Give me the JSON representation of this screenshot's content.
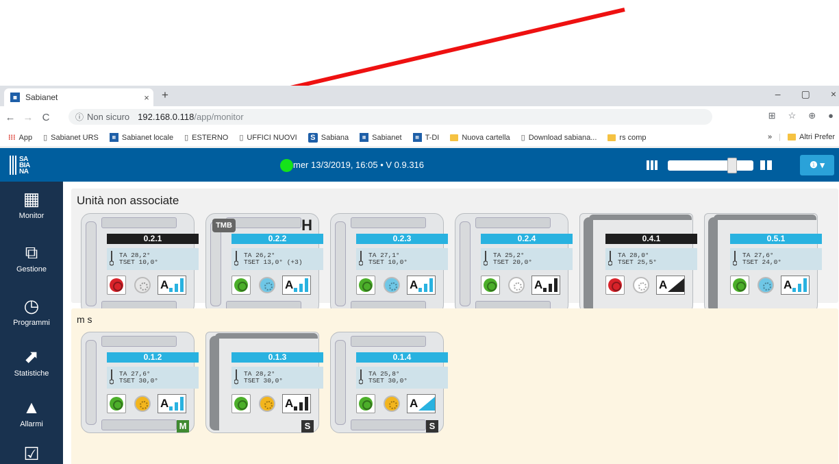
{
  "browser": {
    "tab_title": "Sabianet",
    "tab_close": "×",
    "new_tab": "+",
    "window_controls": [
      "–",
      "▢",
      "×"
    ],
    "nav": {
      "back": "←",
      "forward": "→",
      "reload": "C"
    },
    "security_label": "Non sicuro",
    "url_host": "192.168.0.118",
    "url_path": "/app/monitor",
    "bookmarks": [
      {
        "label": "App",
        "icon": "apps-grid-icon"
      },
      {
        "label": "Sabianet URS",
        "icon": "page-icon"
      },
      {
        "label": "Sabianet locale",
        "icon": "sabianet-favicon"
      },
      {
        "label": "ESTERNO",
        "icon": "page-icon"
      },
      {
        "label": "UFFICI NUOVI",
        "icon": "page-icon"
      },
      {
        "label": "Sabiana",
        "icon": "s-logo-icon"
      },
      {
        "label": "Sabianet",
        "icon": "sabianet-favicon"
      },
      {
        "label": "T-DI",
        "icon": "sabianet-favicon"
      },
      {
        "label": "Nuova cartella",
        "icon": "folder-icon"
      },
      {
        "label": "Download sabiana...",
        "icon": "page-icon"
      },
      {
        "label": "rs comp",
        "icon": "folder-icon"
      }
    ],
    "bookmarks_more": "»",
    "other_bookmarks": "Altri Prefer"
  },
  "app": {
    "logo_text": "SA\nBIA\nNA",
    "status_text": "mer 13/3/2019, 16:05 • V 0.9.316",
    "status_color": "#15e21a",
    "brand_color": "#005e9e",
    "info_label": "❶ ▾",
    "zoom_level": 0.62
  },
  "sidebar": {
    "items": [
      {
        "label": "Monitor",
        "icon": "grid-icon",
        "glyph": "▦"
      },
      {
        "label": "Gestione",
        "icon": "layers-icon",
        "glyph": "⧉"
      },
      {
        "label": "Programmi",
        "icon": "clock-icon",
        "glyph": "◷"
      },
      {
        "label": "Statistiche",
        "icon": "chart-icon",
        "glyph": "⬈"
      },
      {
        "label": "Allarmi",
        "icon": "warning-icon",
        "glyph": "▲"
      },
      {
        "label": "",
        "icon": "checkbox-icon",
        "glyph": "☑"
      }
    ]
  },
  "groups": [
    {
      "title": "Unità non associate",
      "units": [
        {
          "id": "0.2.1",
          "tag": "black",
          "ta": "TA   28,2°",
          "tset": "TSET 10,0°",
          "power": "red",
          "fan": "grey",
          "speed": "bars-cyan",
          "style": "classic"
        },
        {
          "id": "0.2.2",
          "tag": "cyan",
          "ta": "TA   26,2°",
          "tset": "TSET 13,0° (+3)",
          "power": "green",
          "fan": "cyan",
          "speed": "bars-cyan",
          "style": "classic",
          "badge": "TMB",
          "flag": "H"
        },
        {
          "id": "0.2.3",
          "tag": "cyan",
          "ta": "TA   27,1°",
          "tset": "TSET 10,0°",
          "power": "green",
          "fan": "cyan",
          "speed": "bars-cyan",
          "style": "classic"
        },
        {
          "id": "0.2.4",
          "tag": "cyan",
          "ta": "TA   25,2°",
          "tset": "TSET 20,0°",
          "power": "green",
          "fan": "white",
          "speed": "bars-dark",
          "style": "classic"
        },
        {
          "id": "0.4.1",
          "tag": "black",
          "ta": "TA   28,0°",
          "tset": "TSET 25,5°",
          "power": "red",
          "fan": "white",
          "speed": "ramp-dark",
          "style": "dark"
        },
        {
          "id": "0.5.1",
          "tag": "cyan",
          "ta": "TA   27,6°",
          "tset": "TSET 24,0°",
          "power": "green",
          "fan": "cyan",
          "speed": "bars-cyan",
          "style": "dark"
        }
      ]
    },
    {
      "title": "m s",
      "units": [
        {
          "id": "0.1.2",
          "tag": "cyan",
          "ta": "TA   27,6°",
          "tset": "TSET 30,0°",
          "power": "green",
          "fan": "yellow",
          "speed": "bars-cyan",
          "style": "classic",
          "mode": "M",
          "mode_color": "green"
        },
        {
          "id": "0.1.3",
          "tag": "cyan",
          "ta": "TA   28,2°",
          "tset": "TSET 30,0°",
          "power": "green",
          "fan": "yellow",
          "speed": "bars-dark",
          "style": "dark",
          "mode": "S",
          "mode_color": "dark"
        },
        {
          "id": "0.1.4",
          "tag": "cyan",
          "ta": "TA   25,8°",
          "tset": "TSET 30,0°",
          "power": "green",
          "fan": "yellow",
          "speed": "ramp-cyan",
          "style": "classic",
          "mode": "S",
          "mode_color": "dark"
        }
      ]
    }
  ],
  "speed_letter": "A"
}
